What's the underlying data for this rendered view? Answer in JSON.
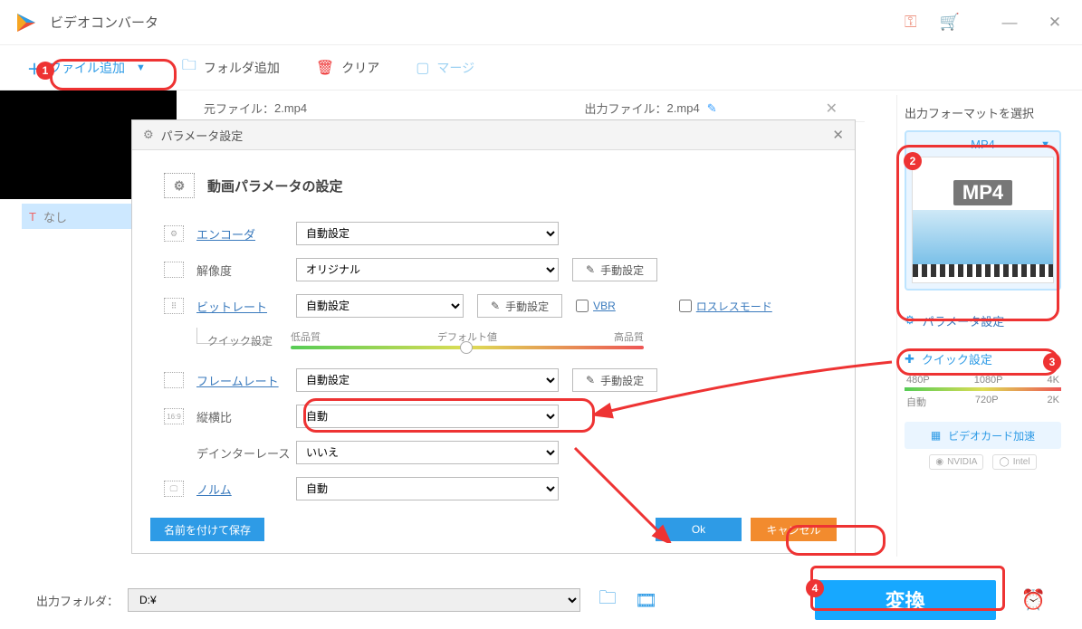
{
  "app": {
    "title": "ビデオコンバータ"
  },
  "toolbar": {
    "add_file": "ファイル追加",
    "add_folder": "フォルダ追加",
    "clear": "クリア",
    "merge": "マージ"
  },
  "item": {
    "title_none": "なし"
  },
  "fileinfo": {
    "source_label": "元ファイル：",
    "source_name": "2.mp4",
    "output_label": "出力ファイル：",
    "output_name": "2.mp4"
  },
  "dialog": {
    "title": "パラメータ設定",
    "section_title": "動画パラメータの設定",
    "rows": {
      "encoder": {
        "label": "エンコーダ",
        "value": "自動設定"
      },
      "resolution": {
        "label": "解像度",
        "value": "オリジナル",
        "manual": "手動設定"
      },
      "bitrate": {
        "label": "ビットレート",
        "value": "自動設定",
        "manual": "手動設定",
        "vbr": "VBR",
        "lossless": "ロスレスモード"
      },
      "quick": {
        "label": "クイック設定",
        "low": "低品質",
        "default": "デフォルト値",
        "high": "高品質"
      },
      "framerate": {
        "label": "フレームレート",
        "value": "自動設定",
        "manual": "手動設定"
      },
      "aspect": {
        "label": "縦横比",
        "value": "自動"
      },
      "deinterlace": {
        "label": "デインターレース",
        "value": "いいえ"
      },
      "norm": {
        "label": "ノルム",
        "value": "自動"
      }
    },
    "save_as": "名前を付けて保存",
    "ok": "Ok",
    "cancel": "キャンセル"
  },
  "sidebar": {
    "title": "出力フォーマットを選択",
    "format": "MP4",
    "thumb_label": "MP4",
    "param_settings": "パラメータ設定",
    "quick_settings": "クイック設定",
    "res": {
      "p480": "480P",
      "p1080": "1080P",
      "k4": "4K",
      "auto": "自動",
      "p720": "720P",
      "k2": "2K"
    },
    "gpu": "ビデオカード加速",
    "vendors": {
      "nvidia": "NVIDIA",
      "intel": "Intel"
    }
  },
  "bottom": {
    "folder_label": "出力フォルダ：",
    "folder_value": "D:¥",
    "convert": "変換"
  },
  "badges": {
    "b1": "1",
    "b2": "2",
    "b3": "3",
    "b4": "4"
  }
}
